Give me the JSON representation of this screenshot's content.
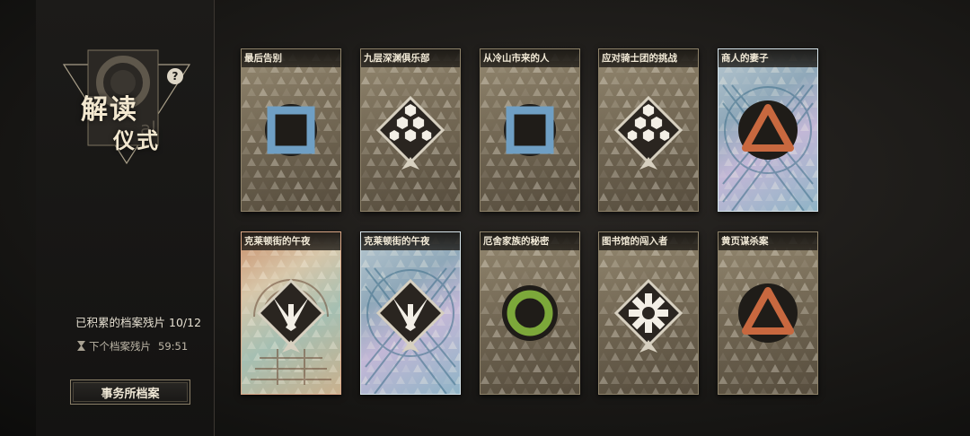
{
  "sidebar": {
    "title_main": "解读",
    "title_sub": "仪式",
    "help_symbol": "?",
    "progress_label": "已积累的档案残片",
    "progress_count": "10/12",
    "timer_label": "下个档案残片",
    "timer_value": "59:51",
    "archive_button_label": "事务所档案"
  },
  "cards": [
    {
      "title": "最后告别",
      "icon": "square-icon",
      "style": "gold"
    },
    {
      "title": "九层深渊俱乐部",
      "icon": "hexagon-cluster-icon",
      "style": "gold"
    },
    {
      "title": "从冷山市来的人",
      "icon": "square-icon",
      "style": "gold"
    },
    {
      "title": "应对骑士团的挑战",
      "icon": "hexagon-cluster-icon",
      "style": "gold"
    },
    {
      "title": "商人的妻子",
      "icon": "triangle-icon",
      "style": "holo-blue"
    },
    {
      "title": "克莱顿街的午夜",
      "icon": "crossed-blades-icon",
      "style": "holo-warm"
    },
    {
      "title": "克莱顿街的午夜",
      "icon": "crossed-blades-icon",
      "style": "holo-blue"
    },
    {
      "title": "厄舍家族的秘密",
      "icon": "ring-icon",
      "style": "gold"
    },
    {
      "title": "图书馆的闯入者",
      "icon": "snowflake-badge-icon",
      "style": "gold"
    },
    {
      "title": "黄页谋杀案",
      "icon": "triangle-icon",
      "style": "gold"
    }
  ],
  "colors": {
    "square_blue": "#6f9fc4",
    "ring_green": "#7ca83a",
    "triangle_orange": "#c8683f",
    "gold_border": "#8f836a"
  }
}
